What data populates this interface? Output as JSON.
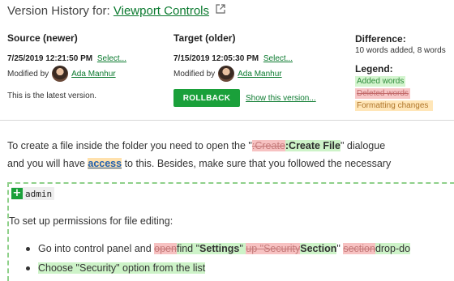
{
  "header": {
    "prefix": "Version History for:",
    "page_title": "Viewport Controls"
  },
  "source": {
    "heading": "Source (newer)",
    "date": "7/25/2019 12:21:50 PM",
    "select_label": "Select...",
    "modified_by_label": "Modified by",
    "user": "Ada Manhur",
    "latest_note": "This is the latest version."
  },
  "target": {
    "heading": "Target (older)",
    "date": "7/15/2019 12:05:30 PM",
    "select_label": "Select...",
    "modified_by_label": "Modified by",
    "user": "Ada Manhur",
    "rollback_label": "ROLLBACK",
    "show_version_label": "Show this version..."
  },
  "difference": {
    "heading": "Difference:",
    "summary": "10 words added, 8 words",
    "legend_heading": "Legend:",
    "legend_added": "Added words",
    "legend_deleted": "Deleted words",
    "legend_formatting": "Formatting changes"
  },
  "content": {
    "p1_a": "To create a file inside the folder you need to open the \"",
    "p1_del": ":Create",
    "p1_ins": ":Create",
    "p1_b": " File",
    "p1_c": "\" dialogue",
    "p2_a": "and you will have ",
    "p2_link": "access",
    "p2_b": " to this. Besides, make sure that you followed the necessary",
    "admin_label": "admin",
    "permissions_text": "To set up permissions for file editing:",
    "b1_a": "Go into control panel and ",
    "b1_del1": "open",
    "b1_ins1": "find \"",
    "b1_ins2": "Settings",
    "b1_ins3": "\" ",
    "b1_del2": "up \"Security",
    "b1_ins4": "Section",
    "b1_c": "\" ",
    "b1_del3": "section",
    "b1_ins5": "drop-do",
    "b2_ins": "Choose \"Security\" option from the list"
  },
  "colors": {
    "accent_green": "#1aa03a",
    "link_green": "#0b7a2f",
    "added_bg": "#cdf3c8",
    "deleted_bg": "#f7c2c2",
    "format_bg": "#ffe1ad"
  }
}
